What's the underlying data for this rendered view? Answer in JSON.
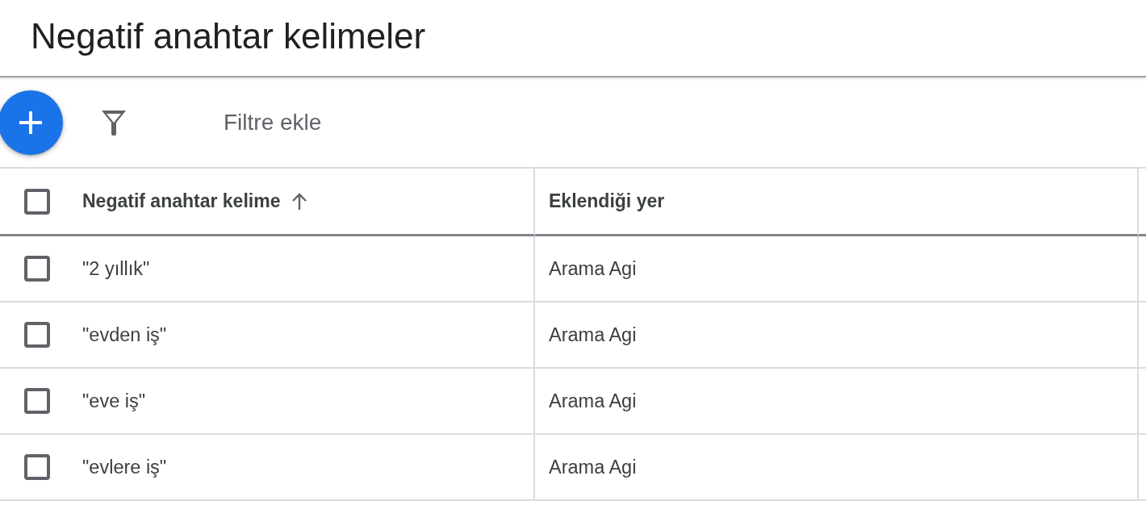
{
  "header": {
    "title": "Negatif anahtar kelimeler"
  },
  "toolbar": {
    "filter_button": "Filtre ekle"
  },
  "table": {
    "select_all": {
      "checked": false
    },
    "columns": [
      {
        "label": "Negatif anahtar kelime",
        "sorted": true
      },
      {
        "label": "Eklendiği yer",
        "sorted": false
      }
    ],
    "rows": [
      {
        "keyword": "\"2 yıllık\"",
        "added_to": "Arama Agi",
        "checked": false
      },
      {
        "keyword": "\"evden iş\"",
        "added_to": "Arama Agi",
        "checked": false
      },
      {
        "keyword": "\"eve iş\"",
        "added_to": "Arama Agi",
        "checked": false
      },
      {
        "keyword": "\"evlere iş\"",
        "added_to": "Arama Agi",
        "checked": false
      }
    ]
  }
}
